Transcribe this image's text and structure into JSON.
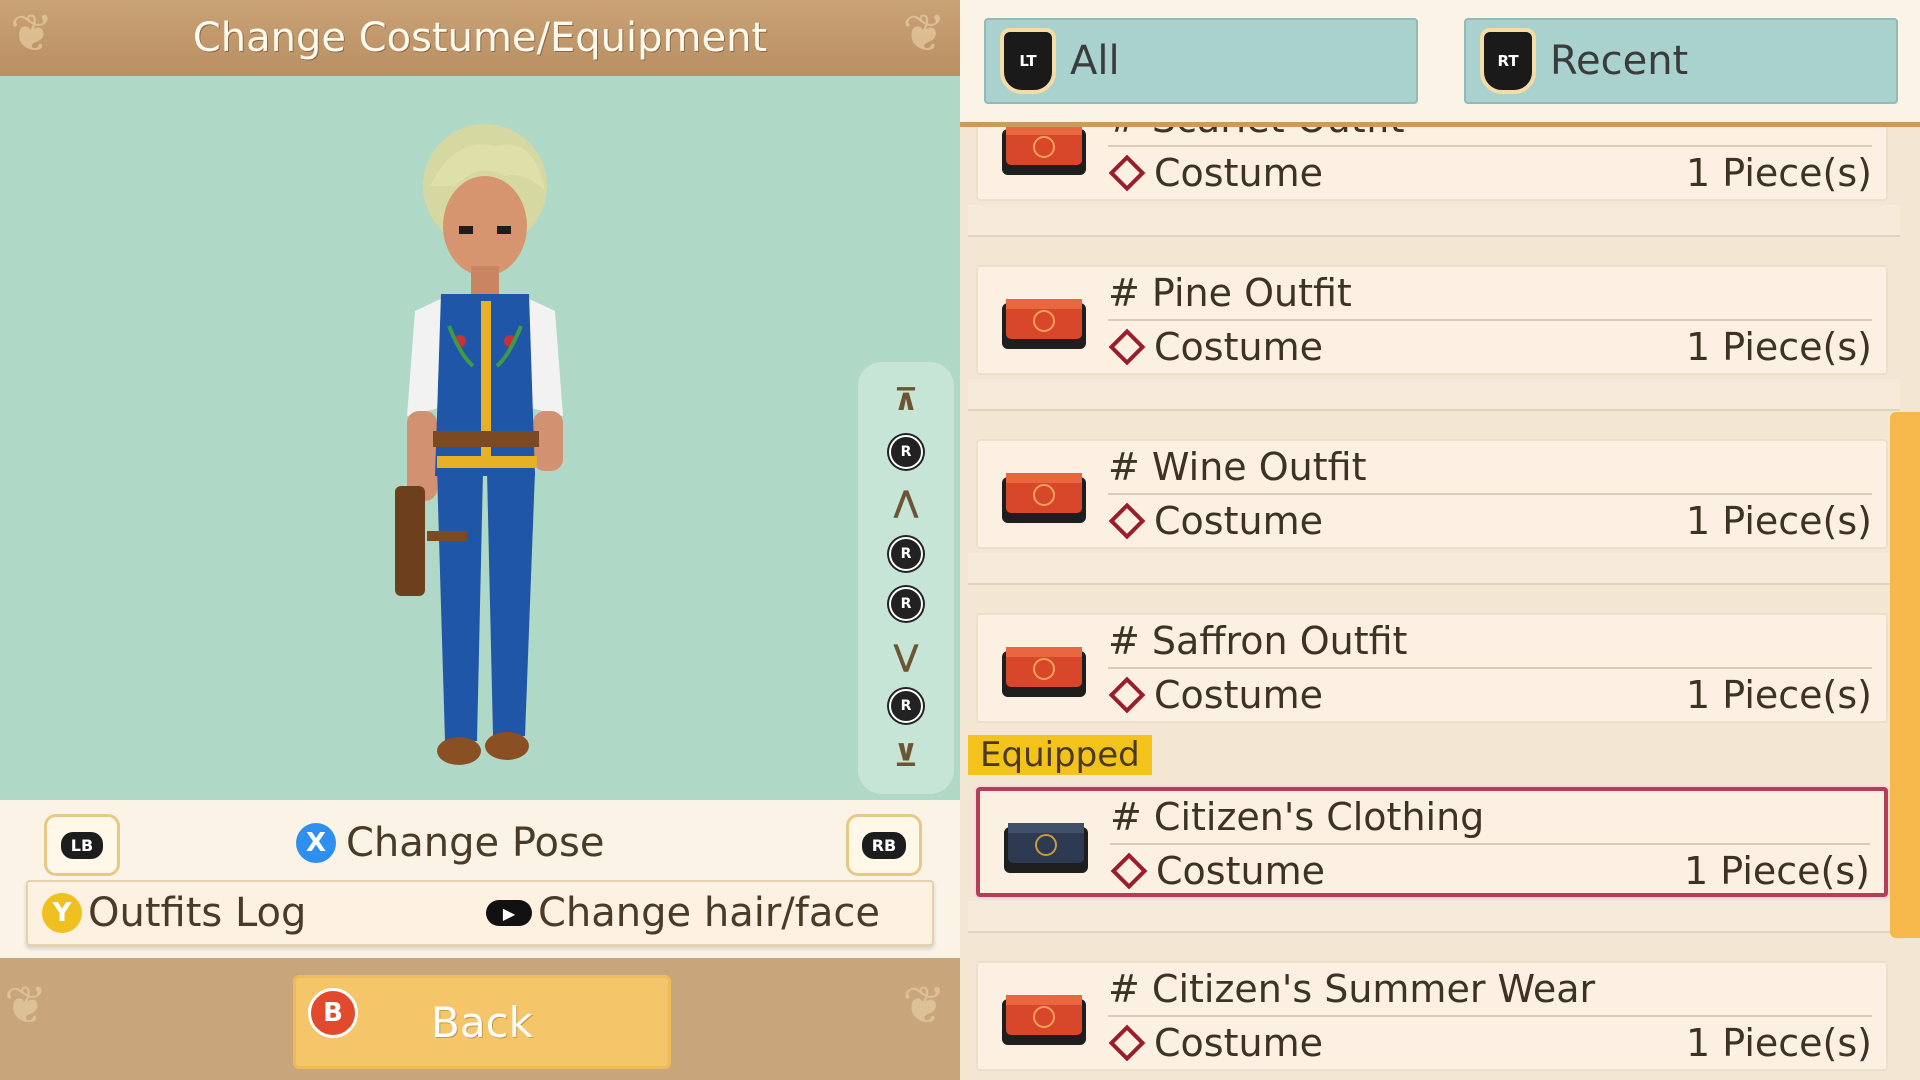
{
  "header": {
    "title": "Change Costume/Equipment"
  },
  "camera": {
    "buttons": [
      {
        "name": "camera-top-icon",
        "glyph": "⊼"
      },
      {
        "name": "camera-up-icon",
        "glyph": "R"
      },
      {
        "name": "camera-zoom-in-icon",
        "glyph": "⋀"
      },
      {
        "name": "camera-rotate-left-icon",
        "glyph": "R"
      },
      {
        "name": "camera-rotate-right-icon",
        "glyph": "R"
      },
      {
        "name": "camera-zoom-out-icon",
        "glyph": "⋁"
      },
      {
        "name": "camera-down-icon",
        "glyph": "R"
      },
      {
        "name": "camera-bottom-icon",
        "glyph": "⊻"
      }
    ]
  },
  "controls": {
    "lb_label": "LB",
    "rb_label": "RB",
    "pose_button": "X",
    "pose_label": "Change Pose",
    "outfits_button": "Y",
    "outfits_label": "Outfits Log",
    "hair_label": "Change hair/face",
    "back_button": "B",
    "back_label": "Back"
  },
  "tabs": [
    {
      "trigger": "LT",
      "label": "All"
    },
    {
      "trigger": "RT",
      "label": "Recent"
    }
  ],
  "equipped_label": "Equipped",
  "items": [
    {
      "name": "# Scarlet Outfit",
      "type": "Costume",
      "qty": "1 Piece(s)",
      "equipped": false
    },
    {
      "name": "# Pine Outfit",
      "type": "Costume",
      "qty": "1 Piece(s)",
      "equipped": false
    },
    {
      "name": "# Wine Outfit",
      "type": "Costume",
      "qty": "1 Piece(s)",
      "equipped": false
    },
    {
      "name": "# Saffron Outfit",
      "type": "Costume",
      "qty": "1 Piece(s)",
      "equipped": false
    },
    {
      "name": "# Citizen's Clothing",
      "type": "Costume",
      "qty": "1 Piece(s)",
      "equipped": true
    },
    {
      "name": "# Citizen's Summer Wear",
      "type": "Costume",
      "qty": "1 Piece(s)",
      "equipped": false
    }
  ],
  "colors": {
    "preview_bg": "#afd8c6",
    "tab_bg": "#a9d2cf",
    "accent": "#f5c56a",
    "selected_border": "#b43d57",
    "equipped_tag": "#f3c21b",
    "x_button": "#2f8ff0",
    "y_button": "#f0c020",
    "b_button": "#e24a2d"
  }
}
